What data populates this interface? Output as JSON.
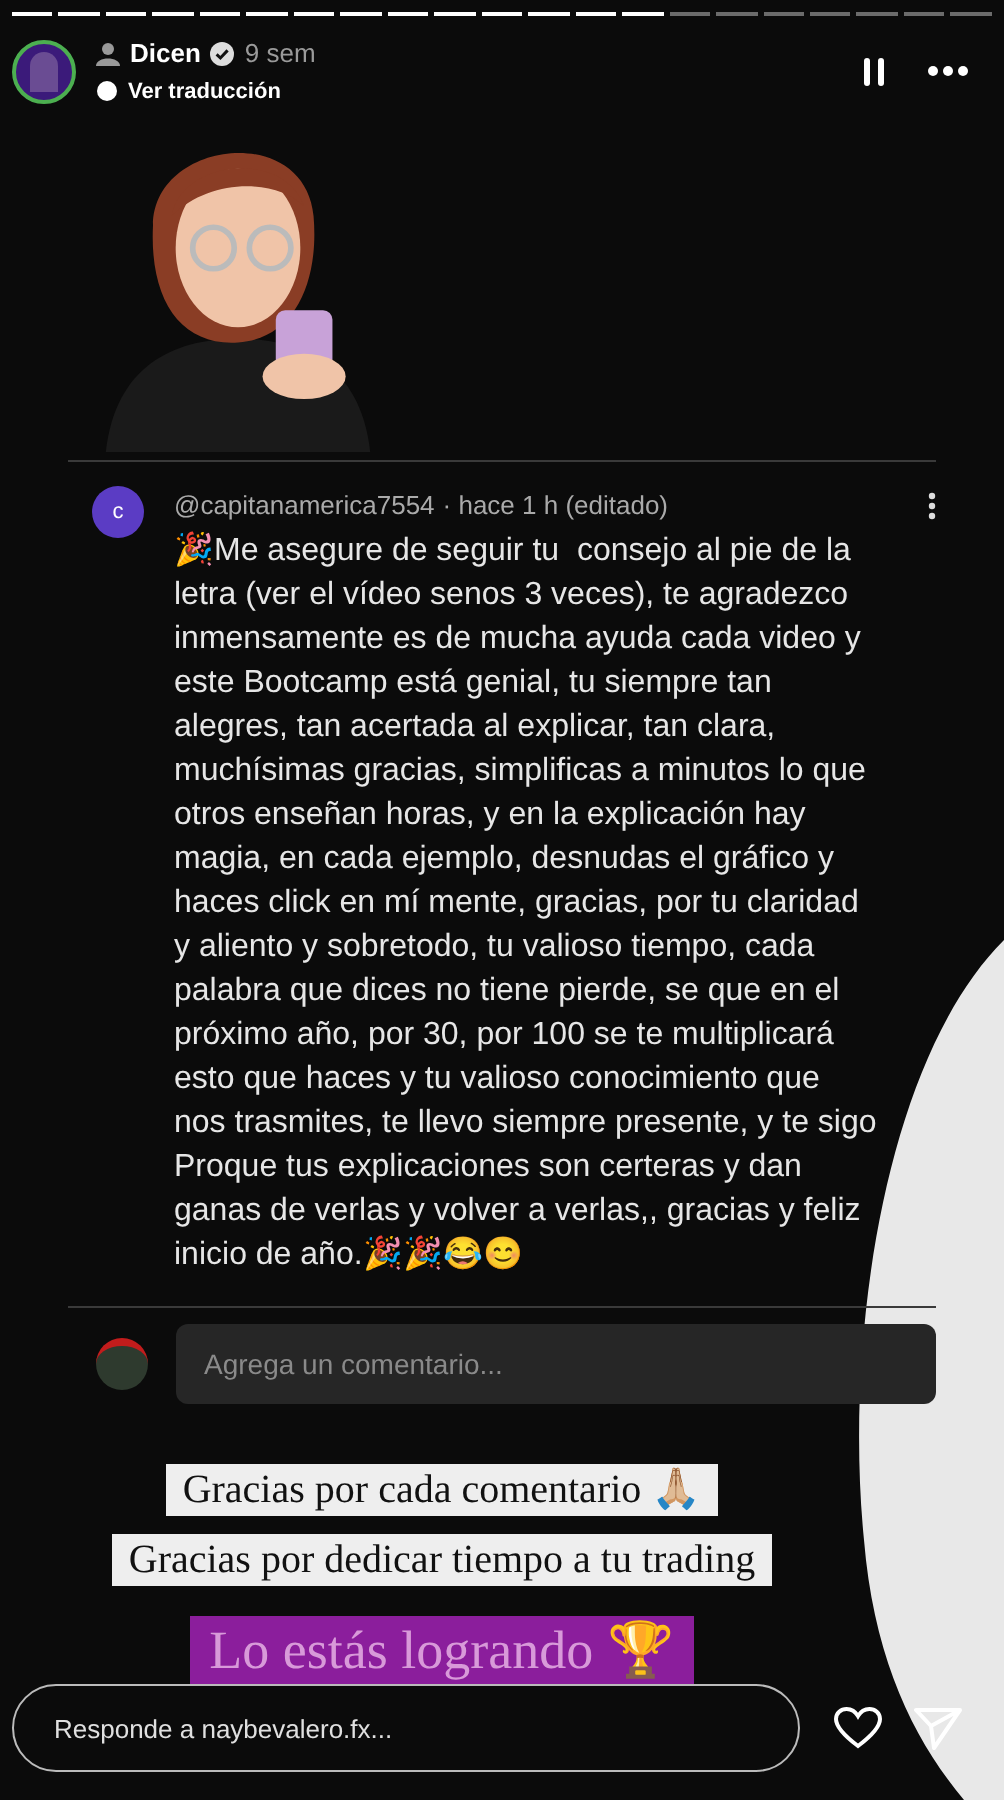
{
  "progress": [
    {
      "viewed": true
    },
    {
      "viewed": true
    },
    {
      "viewed": true
    },
    {
      "viewed": true
    },
    {
      "viewed": true
    },
    {
      "viewed": true
    },
    {
      "viewed": true
    },
    {
      "viewed": true
    },
    {
      "viewed": true
    },
    {
      "viewed": true
    },
    {
      "viewed": true
    },
    {
      "viewed": true
    },
    {
      "viewed": true
    },
    {
      "viewed": true
    },
    {
      "viewed": false
    },
    {
      "viewed": false
    },
    {
      "viewed": false
    },
    {
      "viewed": false
    },
    {
      "viewed": false
    },
    {
      "viewed": false
    },
    {
      "viewed": false
    }
  ],
  "header": {
    "username": "Dicen",
    "verified": true,
    "time": "9 sem",
    "translate": "Ver traducción"
  },
  "comment": {
    "avatar_letter": "c",
    "author": "@capitanamerica7554",
    "meta": "· hace 1 h (editado)",
    "text": "🎉Me asegure de seguir tu  consejo al pie de la letra (ver el vídeo senos 3 veces), te agradezco inmensamente es de mucha ayuda cada video y este Bootcamp está genial, tu siempre tan alegres, tan acertada al explicar, tan clara, muchísimas gracias, simplificas a minutos lo que otros enseñan horas, y en la explicación hay magia, en cada ejemplo, desnudas el gráfico y haces click en mí mente, gracias, por tu claridad y aliento y sobretodo, tu valioso tiempo, cada palabra que dices no tiene pierde, se que en el próximo año, por 30, por 100 se te multiplicará esto que haces y tu valioso conocimiento que nos trasmites, te llevo siempre presente, y te sigo Proque tus explicaciones son certeras y dan ganas de verlas y volver a verlas,, gracias y feliz inicio de año.🎉🎉😂😊"
  },
  "comment_field": {
    "placeholder": "Agrega un comentario..."
  },
  "stickers": [
    {
      "kind": "white",
      "text": "Gracias por cada comentario 🙏🏼"
    },
    {
      "kind": "white",
      "text": "Gracias por dedicar tiempo a tu trading"
    },
    {
      "kind": "purple",
      "text": "Lo estás logrando 🏆"
    }
  ],
  "reply": {
    "placeholder": "Responde a naybevalero.fx..."
  }
}
